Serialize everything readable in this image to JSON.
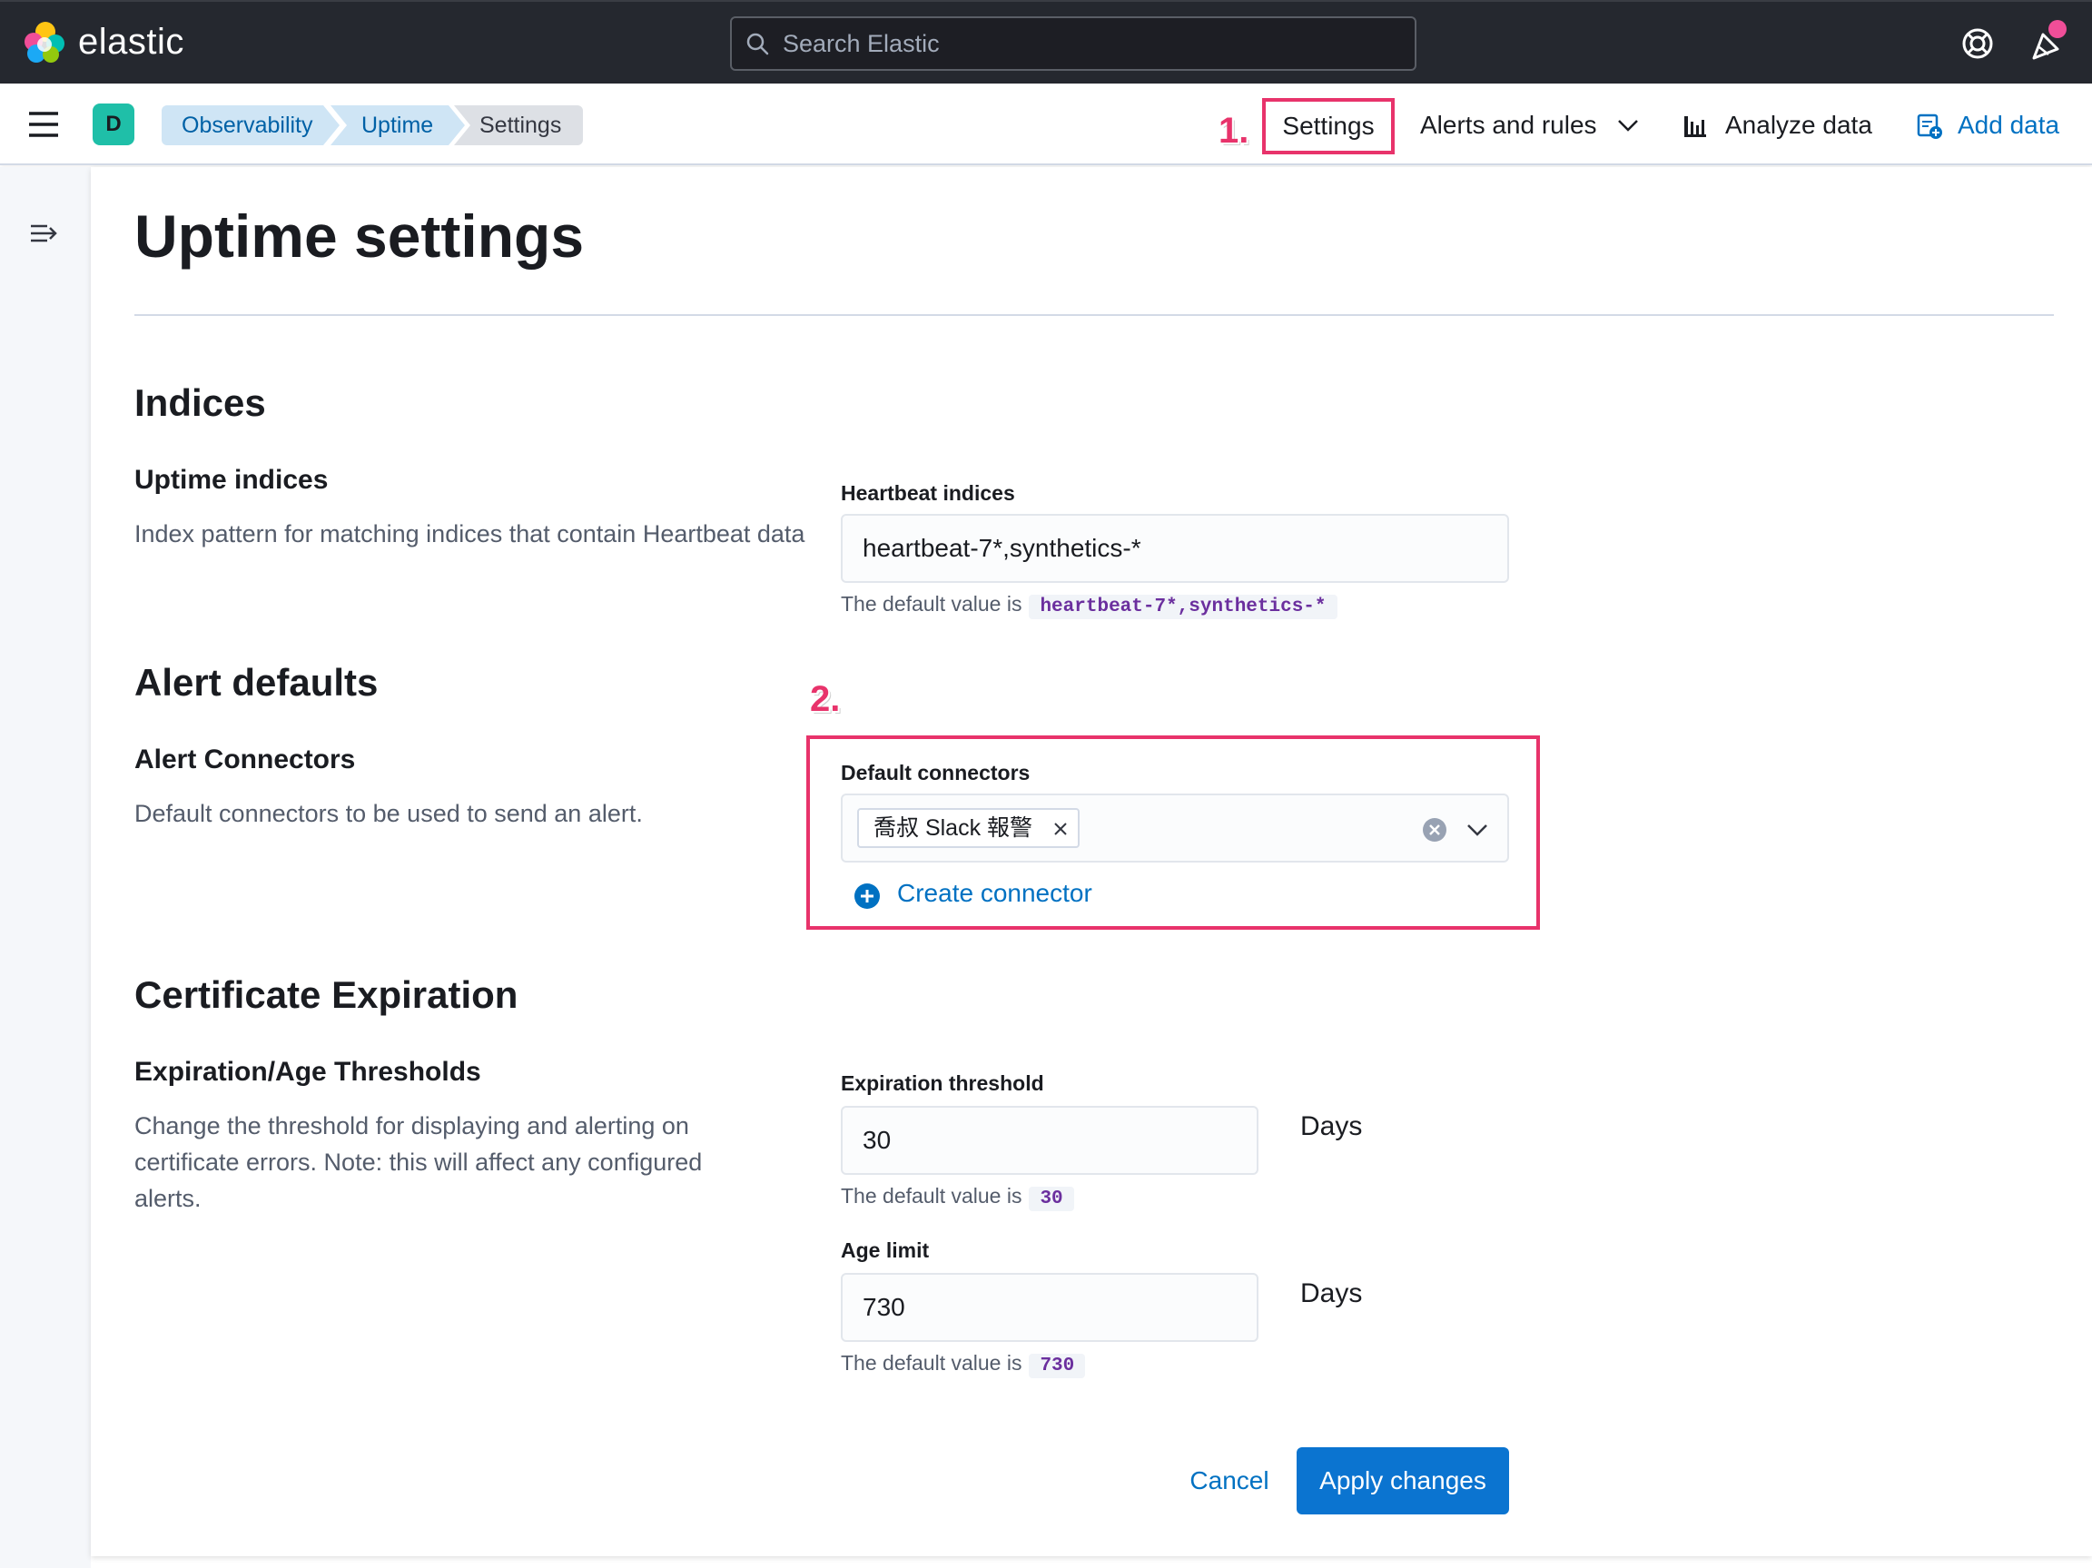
{
  "header": {
    "brand": "elastic",
    "search_placeholder": "Search Elastic"
  },
  "subheader": {
    "space_initial": "D",
    "breadcrumbs": [
      "Observability",
      "Uptime",
      "Settings"
    ],
    "annotation_1": "1.",
    "nav": {
      "settings": "Settings",
      "alerts_and_rules": "Alerts and rules",
      "analyze_data": "Analyze data",
      "add_data": "Add data"
    }
  },
  "page": {
    "title": "Uptime settings",
    "indices": {
      "heading": "Indices",
      "subheading": "Uptime indices",
      "description": "Index pattern for matching indices that contain Heartbeat data",
      "field_label": "Heartbeat indices",
      "field_value": "heartbeat-7*,synthetics-*",
      "default_prefix": "The default value is",
      "default_value": "heartbeat-7*,synthetics-*"
    },
    "alert_defaults": {
      "heading": "Alert defaults",
      "annotation_2": "2.",
      "subheading": "Alert Connectors",
      "description": "Default connectors to be used to send an alert.",
      "field_label": "Default connectors",
      "selected_connectors": [
        "喬叔 Slack 報警"
      ],
      "create_connector_label": "Create connector"
    },
    "certificate_expiration": {
      "heading": "Certificate Expiration",
      "subheading": "Expiration/Age Thresholds",
      "description": "Change the threshold for displaying and alerting on certificate errors. Note: this will affect any configured alerts.",
      "expiration_label": "Expiration threshold",
      "expiration_value": "30",
      "expiration_unit": "Days",
      "expiration_default_prefix": "The default value is",
      "expiration_default": "30",
      "age_label": "Age limit",
      "age_value": "730",
      "age_unit": "Days",
      "age_default_prefix": "The default value is",
      "age_default": "730"
    },
    "actions": {
      "cancel": "Cancel",
      "apply": "Apply changes"
    }
  },
  "colors": {
    "header_bg": "#25282f",
    "accent_blue": "#0071c2",
    "primary_button": "#0b74d0",
    "annotation_pink": "#e8336b",
    "space_avatar": "#1fbfa8",
    "code_text": "#6b2f9e"
  }
}
